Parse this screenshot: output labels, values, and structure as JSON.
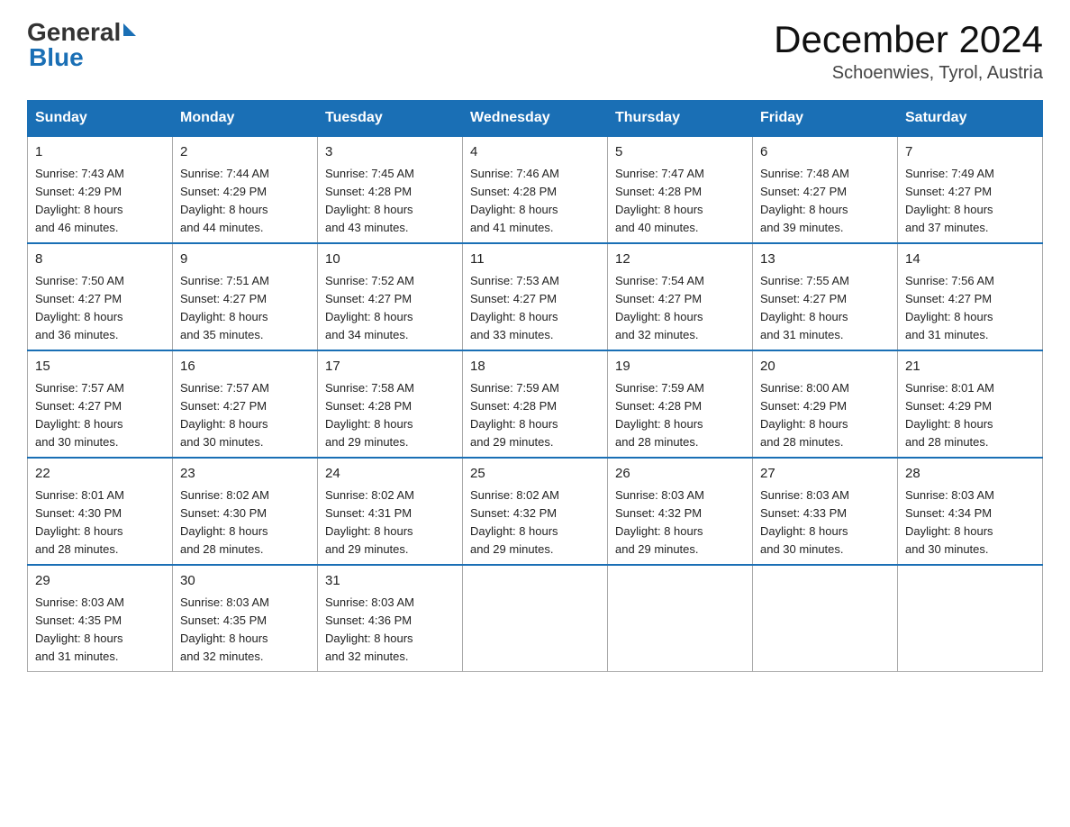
{
  "header": {
    "logo_general": "General",
    "logo_blue": "Blue",
    "month_title": "December 2024",
    "location": "Schoenwies, Tyrol, Austria"
  },
  "weekdays": [
    "Sunday",
    "Monday",
    "Tuesday",
    "Wednesday",
    "Thursday",
    "Friday",
    "Saturday"
  ],
  "weeks": [
    [
      {
        "day": "1",
        "sunrise": "7:43 AM",
        "sunset": "4:29 PM",
        "daylight": "8 hours and 46 minutes."
      },
      {
        "day": "2",
        "sunrise": "7:44 AM",
        "sunset": "4:29 PM",
        "daylight": "8 hours and 44 minutes."
      },
      {
        "day": "3",
        "sunrise": "7:45 AM",
        "sunset": "4:28 PM",
        "daylight": "8 hours and 43 minutes."
      },
      {
        "day": "4",
        "sunrise": "7:46 AM",
        "sunset": "4:28 PM",
        "daylight": "8 hours and 41 minutes."
      },
      {
        "day": "5",
        "sunrise": "7:47 AM",
        "sunset": "4:28 PM",
        "daylight": "8 hours and 40 minutes."
      },
      {
        "day": "6",
        "sunrise": "7:48 AM",
        "sunset": "4:27 PM",
        "daylight": "8 hours and 39 minutes."
      },
      {
        "day": "7",
        "sunrise": "7:49 AM",
        "sunset": "4:27 PM",
        "daylight": "8 hours and 37 minutes."
      }
    ],
    [
      {
        "day": "8",
        "sunrise": "7:50 AM",
        "sunset": "4:27 PM",
        "daylight": "8 hours and 36 minutes."
      },
      {
        "day": "9",
        "sunrise": "7:51 AM",
        "sunset": "4:27 PM",
        "daylight": "8 hours and 35 minutes."
      },
      {
        "day": "10",
        "sunrise": "7:52 AM",
        "sunset": "4:27 PM",
        "daylight": "8 hours and 34 minutes."
      },
      {
        "day": "11",
        "sunrise": "7:53 AM",
        "sunset": "4:27 PM",
        "daylight": "8 hours and 33 minutes."
      },
      {
        "day": "12",
        "sunrise": "7:54 AM",
        "sunset": "4:27 PM",
        "daylight": "8 hours and 32 minutes."
      },
      {
        "day": "13",
        "sunrise": "7:55 AM",
        "sunset": "4:27 PM",
        "daylight": "8 hours and 31 minutes."
      },
      {
        "day": "14",
        "sunrise": "7:56 AM",
        "sunset": "4:27 PM",
        "daylight": "8 hours and 31 minutes."
      }
    ],
    [
      {
        "day": "15",
        "sunrise": "7:57 AM",
        "sunset": "4:27 PM",
        "daylight": "8 hours and 30 minutes."
      },
      {
        "day": "16",
        "sunrise": "7:57 AM",
        "sunset": "4:27 PM",
        "daylight": "8 hours and 30 minutes."
      },
      {
        "day": "17",
        "sunrise": "7:58 AM",
        "sunset": "4:28 PM",
        "daylight": "8 hours and 29 minutes."
      },
      {
        "day": "18",
        "sunrise": "7:59 AM",
        "sunset": "4:28 PM",
        "daylight": "8 hours and 29 minutes."
      },
      {
        "day": "19",
        "sunrise": "7:59 AM",
        "sunset": "4:28 PM",
        "daylight": "8 hours and 28 minutes."
      },
      {
        "day": "20",
        "sunrise": "8:00 AM",
        "sunset": "4:29 PM",
        "daylight": "8 hours and 28 minutes."
      },
      {
        "day": "21",
        "sunrise": "8:01 AM",
        "sunset": "4:29 PM",
        "daylight": "8 hours and 28 minutes."
      }
    ],
    [
      {
        "day": "22",
        "sunrise": "8:01 AM",
        "sunset": "4:30 PM",
        "daylight": "8 hours and 28 minutes."
      },
      {
        "day": "23",
        "sunrise": "8:02 AM",
        "sunset": "4:30 PM",
        "daylight": "8 hours and 28 minutes."
      },
      {
        "day": "24",
        "sunrise": "8:02 AM",
        "sunset": "4:31 PM",
        "daylight": "8 hours and 29 minutes."
      },
      {
        "day": "25",
        "sunrise": "8:02 AM",
        "sunset": "4:32 PM",
        "daylight": "8 hours and 29 minutes."
      },
      {
        "day": "26",
        "sunrise": "8:03 AM",
        "sunset": "4:32 PM",
        "daylight": "8 hours and 29 minutes."
      },
      {
        "day": "27",
        "sunrise": "8:03 AM",
        "sunset": "4:33 PM",
        "daylight": "8 hours and 30 minutes."
      },
      {
        "day": "28",
        "sunrise": "8:03 AM",
        "sunset": "4:34 PM",
        "daylight": "8 hours and 30 minutes."
      }
    ],
    [
      {
        "day": "29",
        "sunrise": "8:03 AM",
        "sunset": "4:35 PM",
        "daylight": "8 hours and 31 minutes."
      },
      {
        "day": "30",
        "sunrise": "8:03 AM",
        "sunset": "4:35 PM",
        "daylight": "8 hours and 32 minutes."
      },
      {
        "day": "31",
        "sunrise": "8:03 AM",
        "sunset": "4:36 PM",
        "daylight": "8 hours and 32 minutes."
      },
      null,
      null,
      null,
      null
    ]
  ],
  "labels": {
    "sunrise": "Sunrise:",
    "sunset": "Sunset:",
    "daylight": "Daylight:"
  }
}
